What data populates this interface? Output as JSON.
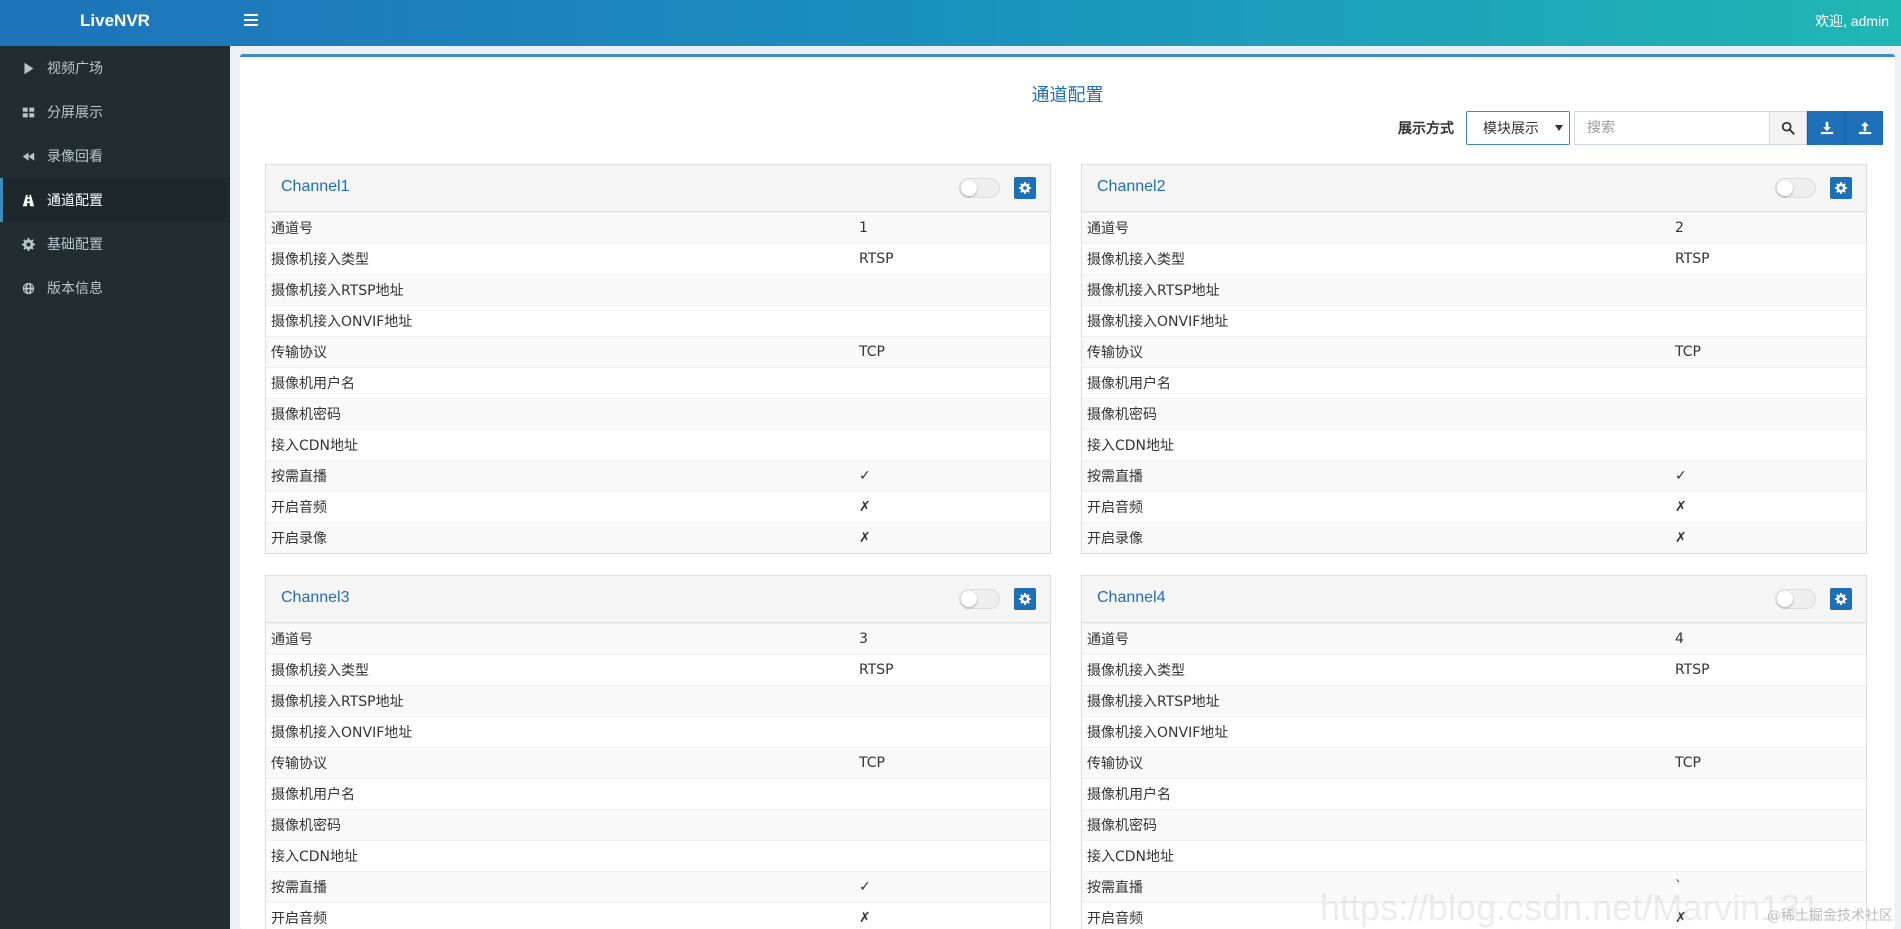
{
  "app": {
    "brand": "LiveNVR",
    "welcome": "欢迎, admin"
  },
  "sidebar": {
    "items": [
      {
        "label": "视频广场",
        "icon": "play-icon",
        "active": false
      },
      {
        "label": "分屏展示",
        "icon": "grid-icon",
        "active": false
      },
      {
        "label": "录像回看",
        "icon": "backward-icon",
        "active": false
      },
      {
        "label": "通道配置",
        "icon": "road-icon",
        "active": true
      },
      {
        "label": "基础配置",
        "icon": "gear-icon",
        "active": false
      },
      {
        "label": "版本信息",
        "icon": "globe-icon",
        "active": false
      }
    ]
  },
  "main": {
    "title": "通道配置",
    "display_mode_label": "展示方式",
    "display_mode_value": "模块展示",
    "search_placeholder": "搜索"
  },
  "channels": [
    {
      "name": "Channel1",
      "rows": [
        {
          "key": "通道号",
          "value": "1"
        },
        {
          "key": "摄像机接入类型",
          "value": "RTSP"
        },
        {
          "key": "摄像机接入RTSP地址",
          "value": ""
        },
        {
          "key": "摄像机接入ONVIF地址",
          "value": ""
        },
        {
          "key": "传输协议",
          "value": "TCP"
        },
        {
          "key": "摄像机用户名",
          "value": ""
        },
        {
          "key": "摄像机密码",
          "value": ""
        },
        {
          "key": "接入CDN地址",
          "value": ""
        },
        {
          "key": "按需直播",
          "value": "✓"
        },
        {
          "key": "开启音频",
          "value": "✗"
        },
        {
          "key": "开启录像",
          "value": "✗"
        }
      ]
    },
    {
      "name": "Channel2",
      "rows": [
        {
          "key": "通道号",
          "value": "2"
        },
        {
          "key": "摄像机接入类型",
          "value": "RTSP"
        },
        {
          "key": "摄像机接入RTSP地址",
          "value": ""
        },
        {
          "key": "摄像机接入ONVIF地址",
          "value": ""
        },
        {
          "key": "传输协议",
          "value": "TCP"
        },
        {
          "key": "摄像机用户名",
          "value": ""
        },
        {
          "key": "摄像机密码",
          "value": ""
        },
        {
          "key": "接入CDN地址",
          "value": ""
        },
        {
          "key": "按需直播",
          "value": "✓"
        },
        {
          "key": "开启音频",
          "value": "✗"
        },
        {
          "key": "开启录像",
          "value": "✗"
        }
      ]
    },
    {
      "name": "Channel3",
      "rows": [
        {
          "key": "通道号",
          "value": "3"
        },
        {
          "key": "摄像机接入类型",
          "value": "RTSP"
        },
        {
          "key": "摄像机接入RTSP地址",
          "value": ""
        },
        {
          "key": "摄像机接入ONVIF地址",
          "value": ""
        },
        {
          "key": "传输协议",
          "value": "TCP"
        },
        {
          "key": "摄像机用户名",
          "value": ""
        },
        {
          "key": "摄像机密码",
          "value": ""
        },
        {
          "key": "接入CDN地址",
          "value": ""
        },
        {
          "key": "按需直播",
          "value": "✓"
        },
        {
          "key": "开启音频",
          "value": "✗"
        }
      ]
    },
    {
      "name": "Channel4",
      "rows": [
        {
          "key": "通道号",
          "value": "4"
        },
        {
          "key": "摄像机接入类型",
          "value": "RTSP"
        },
        {
          "key": "摄像机接入RTSP地址",
          "value": ""
        },
        {
          "key": "摄像机接入ONVIF地址",
          "value": ""
        },
        {
          "key": "传输协议",
          "value": "TCP"
        },
        {
          "key": "摄像机用户名",
          "value": ""
        },
        {
          "key": "摄像机密码",
          "value": ""
        },
        {
          "key": "接入CDN地址",
          "value": ""
        },
        {
          "key": "按需直播",
          "value": "`"
        },
        {
          "key": "开启音频",
          "value": "✗"
        }
      ]
    }
  ],
  "watermark": {
    "text": "@稀土掘金技术社区",
    "url_overlay": "https://blog.csdn.net/Marvin131"
  },
  "colors": {
    "accent": "#1d6fb8",
    "sidebar_bg": "#222d32",
    "header_start": "#1f73b9",
    "header_end": "#1fb7b4"
  }
}
